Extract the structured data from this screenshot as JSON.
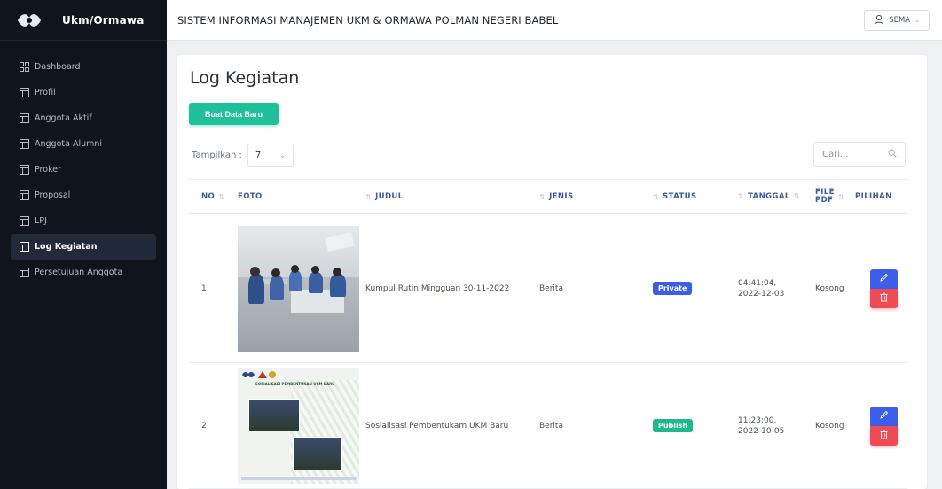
{
  "sidebar": {
    "brand": "Ukm/Ormawa",
    "items": [
      {
        "label": "Dashboard",
        "icon": "grid-icon",
        "active": false
      },
      {
        "label": "Profil",
        "icon": "table-icon",
        "active": false
      },
      {
        "label": "Anggota Aktif",
        "icon": "table-icon",
        "active": false
      },
      {
        "label": "Anggota Alumni",
        "icon": "table-icon",
        "active": false
      },
      {
        "label": "Proker",
        "icon": "table-icon",
        "active": false
      },
      {
        "label": "Proposal",
        "icon": "table-icon",
        "active": false
      },
      {
        "label": "LPJ",
        "icon": "table-icon",
        "active": false
      },
      {
        "label": "Log Kegiatan",
        "icon": "table-icon",
        "active": true
      },
      {
        "label": "Persetujuan Anggota",
        "icon": "table-icon",
        "active": false
      }
    ]
  },
  "topbar": {
    "title": "SISTEM INFORMASI MANAJEMEN UKM & ORMAWA POLMAN NEGERI BABEL",
    "user": "SEMA"
  },
  "main": {
    "page_title": "Log Kegiatan",
    "new_button": "Buat Data Baru",
    "show_label": "Tampilkan :",
    "show_value": "7",
    "search_placeholder": "Cari...",
    "columns": {
      "no": "NO",
      "foto": "FOTO",
      "judul": "JUDUL",
      "jenis": "JENIS",
      "status": "STATUS",
      "tanggal": "TANGGAL",
      "file_pdf_1": "FILE",
      "file_pdf_2": "PDF",
      "pilihan": "PILIHAN"
    },
    "rows": [
      {
        "no": "1",
        "judul": "Kumpul Rutin Mingguan 30-11-2022",
        "jenis": "Berita",
        "status": "Private",
        "tanggal_1": "04:41:04,",
        "tanggal_2": "2022-12-03",
        "file_pdf": "Kosong"
      },
      {
        "no": "2",
        "judul": "Sosialisasi Pembentukam UKM Baru",
        "jenis": "Berita",
        "status": "Publish",
        "tanggal_1": "11:23:00,",
        "tanggal_2": "2022-10-05",
        "file_pdf": "Kosong"
      }
    ],
    "poster_text": "SOSIALISASI PEMBENTUKAN UKM BARU"
  },
  "colors": {
    "accent_green": "#20c09a",
    "badge_private": "#3b5de7",
    "badge_publish": "#1fb98c",
    "edit_blue": "#3d5ee8",
    "delete_red": "#ee4b54",
    "sidebar_bg": "#10141d"
  }
}
